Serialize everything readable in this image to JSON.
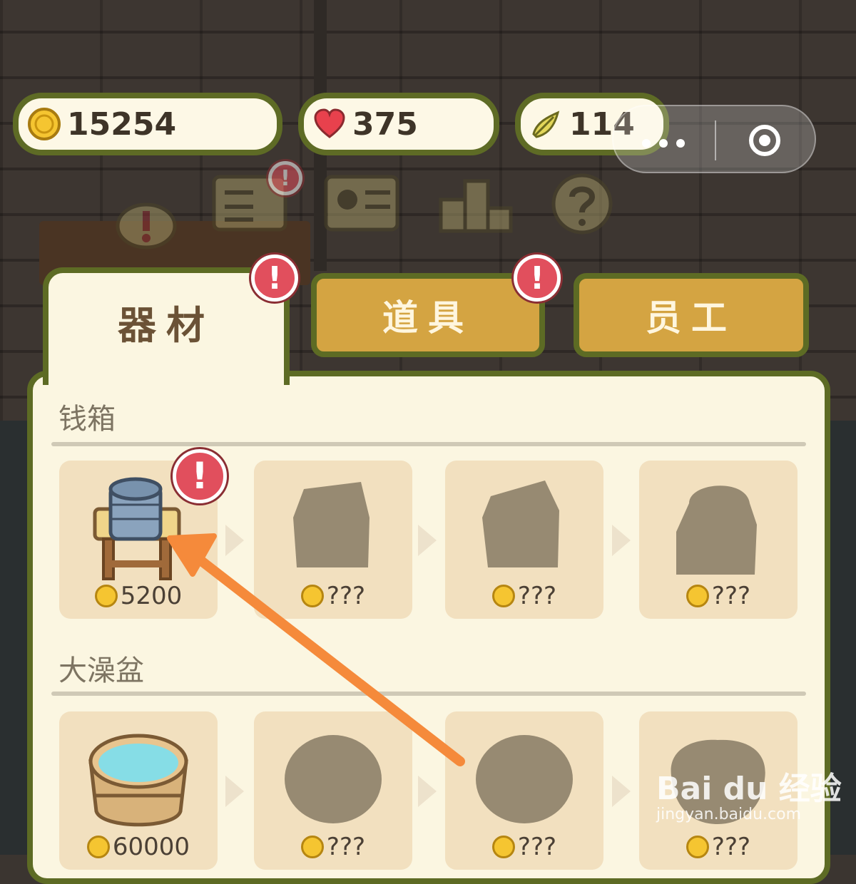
{
  "currencies": {
    "coins": "15254",
    "hearts": "375",
    "leaves": "114"
  },
  "tabs": [
    {
      "label": "器材",
      "active": true
    },
    {
      "label": "道具",
      "active": false
    },
    {
      "label": "员工",
      "active": false
    }
  ],
  "sections": [
    {
      "title": "钱箱",
      "items": [
        {
          "price": "5200",
          "unlocked": true
        },
        {
          "price": "???",
          "unlocked": false
        },
        {
          "price": "???",
          "unlocked": false
        },
        {
          "price": "???",
          "unlocked": false
        }
      ]
    },
    {
      "title": "大澡盆",
      "items": [
        {
          "price": "60000",
          "unlocked": true
        },
        {
          "price": "???",
          "unlocked": false
        },
        {
          "price": "???",
          "unlocked": false
        },
        {
          "price": "???",
          "unlocked": false
        }
      ]
    }
  ],
  "badge_symbol": "!",
  "watermark": {
    "main": "Bai du 经验",
    "sub": "jingyan.baidu.com"
  },
  "colors": {
    "panel": "#fbf6e1",
    "border": "#5d6b24",
    "tab_inactive": "#d4a442",
    "badge": "#e14f5d",
    "arrow": "#f58a3b"
  }
}
